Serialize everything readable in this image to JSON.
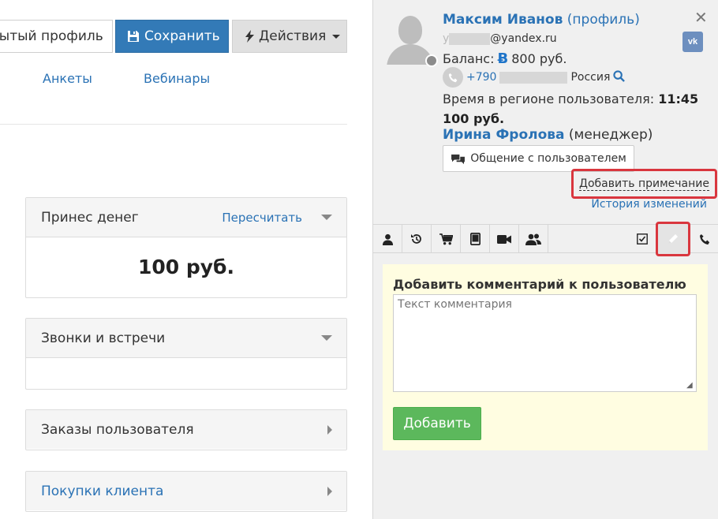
{
  "toolbar": {
    "open_profile_label": "рытый профиль",
    "save_label": "Сохранить",
    "actions_label": "Действия"
  },
  "tabs": [
    {
      "label": "Анкеты"
    },
    {
      "label": "Вебинары"
    }
  ],
  "panels": {
    "money": {
      "title": "Принес денег",
      "recalc_label": "Пересчитать",
      "value": "100 руб."
    },
    "calls": {
      "title": "Звонки и встречи"
    },
    "orders": {
      "title": "Заказы пользователя"
    },
    "purchases": {
      "title": "Покупки клиента"
    }
  },
  "user": {
    "name": "Максим Иванов",
    "profile_link": "(профиль)",
    "email_visible": "@yandex.ru",
    "email_prefix": "y",
    "balance_label": "Баланс:",
    "balance_value": "800 руб.",
    "phone_prefix": "+790",
    "country": "Россия",
    "region_time_label": "Время в регионе пользователя:",
    "region_time_value": "11:45",
    "spent": "100 руб.",
    "vk_label": "vk"
  },
  "manager": {
    "name": "Ирина Фролова",
    "role": "(менеджер)"
  },
  "actions": {
    "chat_label": "Общение с пользователем",
    "add_note_label": "Добавить примечание",
    "history_label": "История изменений"
  },
  "comment": {
    "title": "Добавить комментарий к пользователю",
    "placeholder": "Текст комментария",
    "submit_label": "Добавить"
  },
  "colors": {
    "link": "#2a72b5",
    "primary": "#337ab7",
    "success": "#5cb85c",
    "highlight": "#d9363e",
    "note_bg": "#fffde1"
  }
}
